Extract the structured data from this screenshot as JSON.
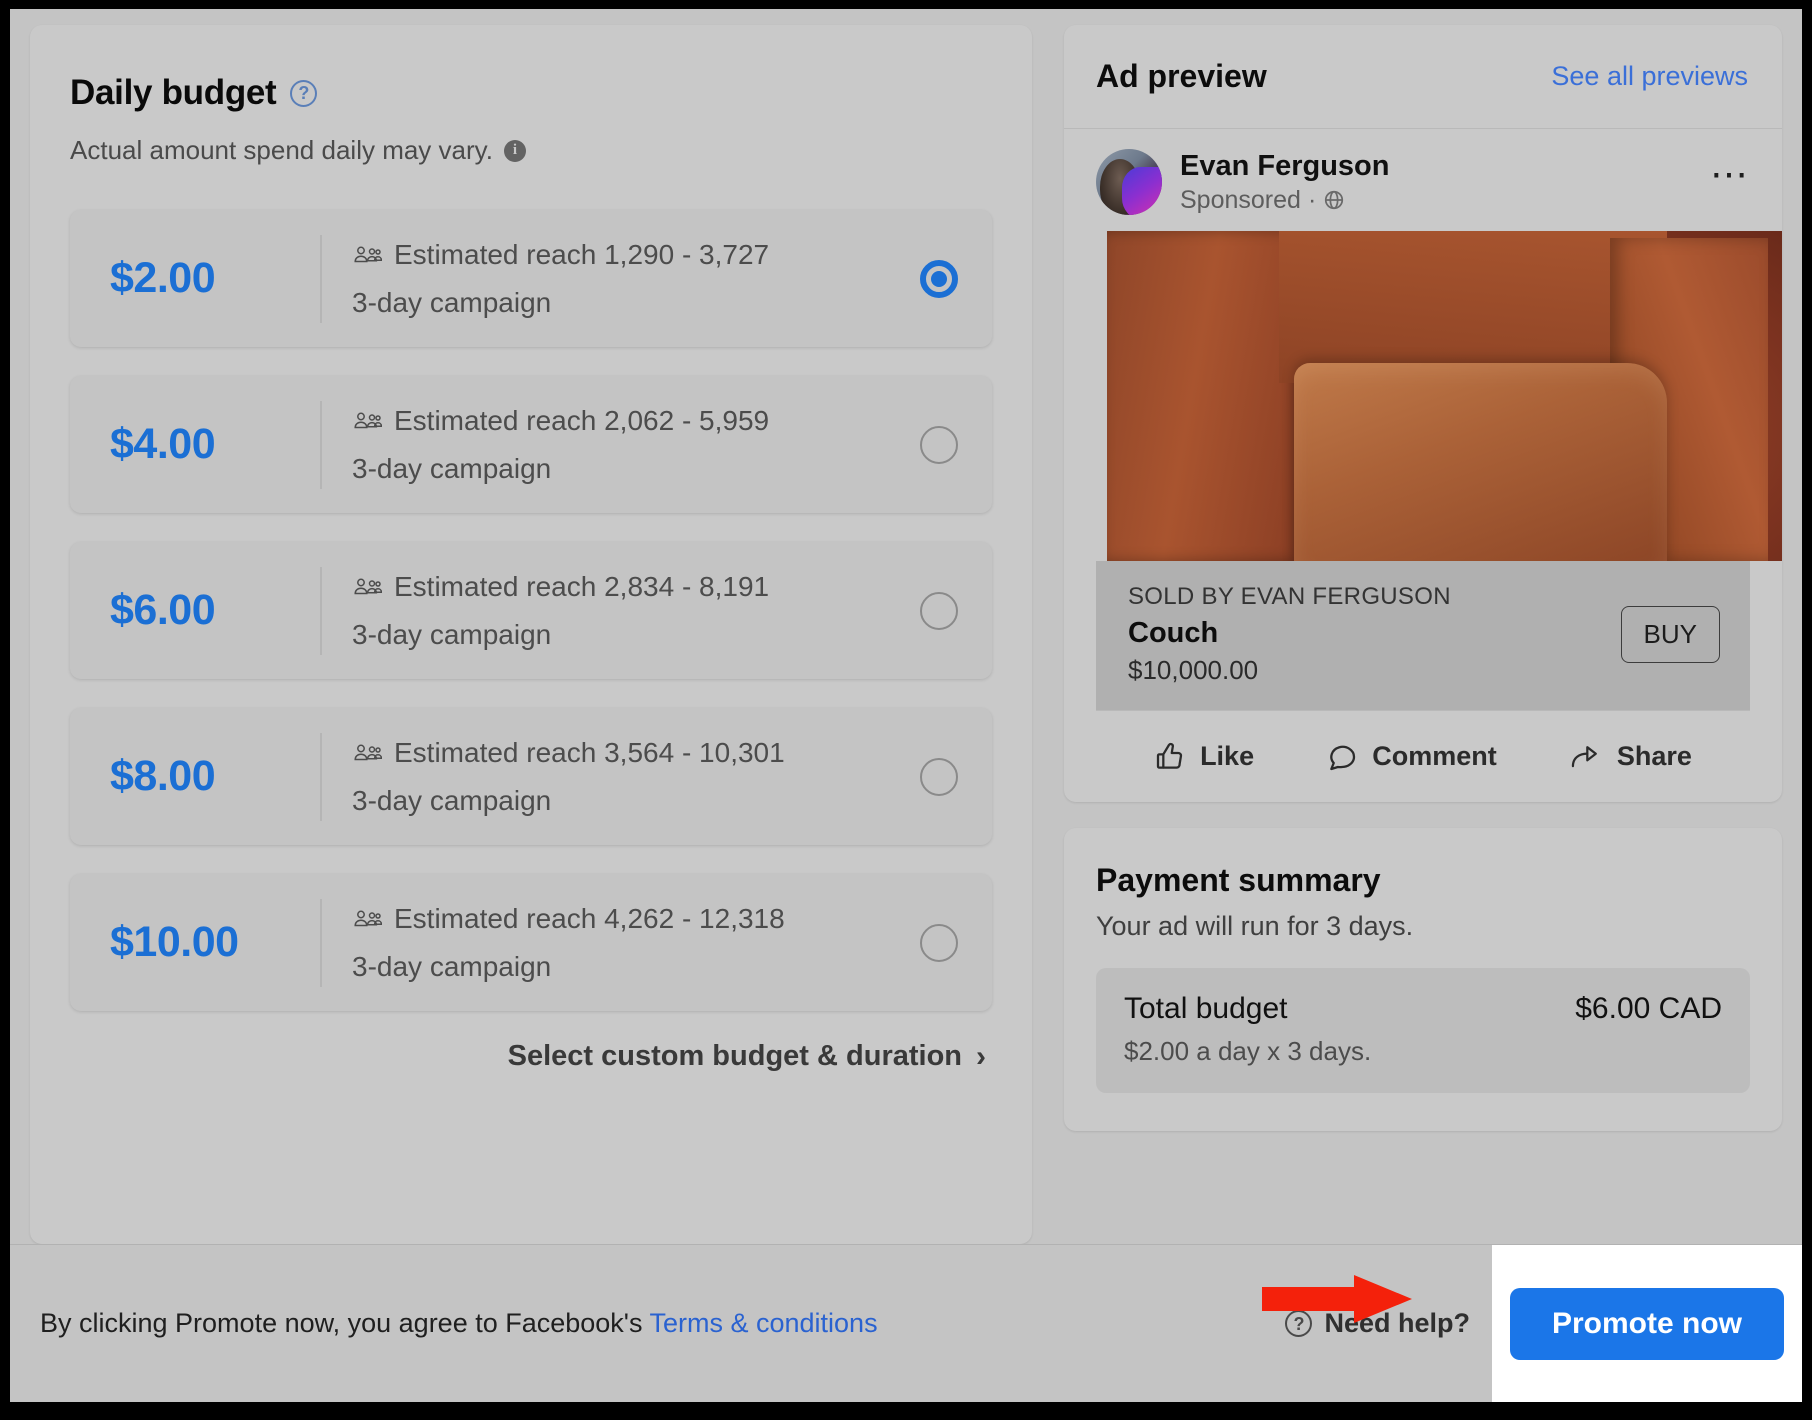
{
  "left_panel": {
    "title": "Daily budget",
    "help_icon": "question-circle-icon",
    "subtitle": "Actual amount spend daily may vary.",
    "info_icon": "info-icon",
    "budget_options": [
      {
        "amount": "$2.00",
        "reach": "Estimated reach 1,290 - 3,727",
        "duration": "3-day campaign",
        "selected": true
      },
      {
        "amount": "$4.00",
        "reach": "Estimated reach 2,062 - 5,959",
        "duration": "3-day campaign",
        "selected": false
      },
      {
        "amount": "$6.00",
        "reach": "Estimated reach 2,834 - 8,191",
        "duration": "3-day campaign",
        "selected": false
      },
      {
        "amount": "$8.00",
        "reach": "Estimated reach 3,564 - 10,301",
        "duration": "3-day campaign",
        "selected": false
      },
      {
        "amount": "$10.00",
        "reach": "Estimated reach 4,262 - 12,318",
        "duration": "3-day campaign",
        "selected": false
      }
    ],
    "custom_budget_link": "Select custom budget & duration",
    "custom_budget_chevron": "chevron-right-icon"
  },
  "ad_preview": {
    "header_title": "Ad preview",
    "see_all_link": "See all previews",
    "post": {
      "author": "Evan Ferguson",
      "meta": "Sponsored",
      "meta_separator": "·",
      "globe_icon": "globe-icon",
      "more_icon": "ellipsis-icon",
      "avatar": "profile-avatar"
    },
    "product": {
      "sold_by": "SOLD BY EVAN FERGUSON",
      "name": "Couch",
      "price": "$10,000.00",
      "buy_label": "BUY"
    },
    "actions": [
      {
        "label": "Like",
        "icon": "thumbs-up-icon"
      },
      {
        "label": "Comment",
        "icon": "comment-bubble-icon"
      },
      {
        "label": "Share",
        "icon": "share-arrow-icon"
      }
    ]
  },
  "payment_summary": {
    "title": "Payment summary",
    "subtitle": "Your ad will run for 3 days.",
    "total_label": "Total budget",
    "total_value": "$6.00 CAD",
    "note": "$2.00 a day x 3 days."
  },
  "footer": {
    "terms_prefix": "By clicking Promote now, you agree to Facebook's ",
    "terms_link": "Terms & conditions",
    "need_help": "Need help?",
    "need_help_icon": "question-circle-icon",
    "promote_label": "Promote now"
  },
  "colors": {
    "page_bg": "#c4c4c4",
    "panel_bg": "#c9c9c9",
    "accent_blue": "#1b6fd4",
    "link_blue": "#2a62d0",
    "button_blue": "#1b76e8",
    "annotation_red": "#f4210b",
    "highlight_white": "#ffffff"
  }
}
